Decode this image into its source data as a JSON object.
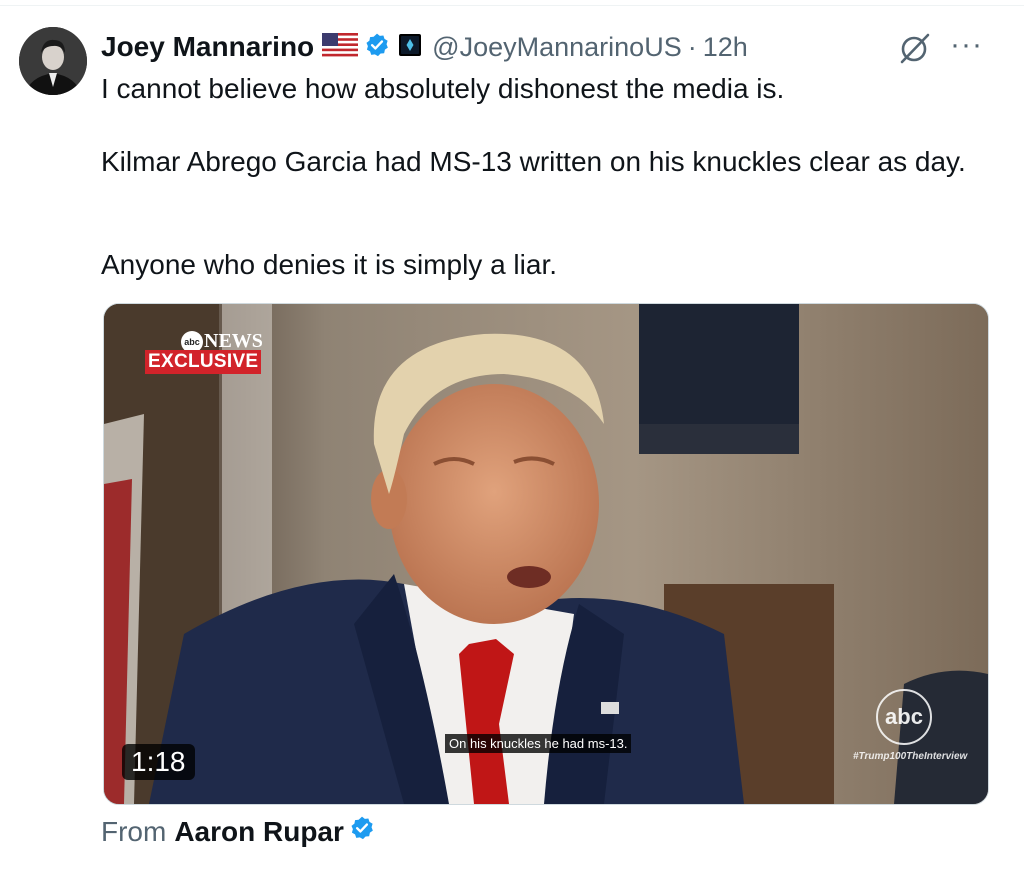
{
  "author": {
    "name": "Joey Mannarino",
    "handle": "@JoeyMannarinoUS",
    "separator": "·",
    "time": "12h",
    "flag_icon": "us-flag-icon",
    "verified_color": "#1d9bf0"
  },
  "tweet": {
    "paragraph1": "I cannot believe how absolutely dishonest the media is.",
    "paragraph2": "Kilmar Abrego Garcia had MS-13 written on his knuckles clear as day.",
    "paragraph3": "Anyone who denies it is simply a liar."
  },
  "video": {
    "network": "NEWS",
    "network_ball": "abc",
    "badge": "EXCLUSIVE",
    "caption": "On his knuckles he had ms-13.",
    "watermark": "abc",
    "hashtag": "#Trump100TheInterview",
    "duration": "1:18"
  },
  "source": {
    "label": "From",
    "name": "Aaron Rupar"
  },
  "actions": {
    "more": "···"
  }
}
